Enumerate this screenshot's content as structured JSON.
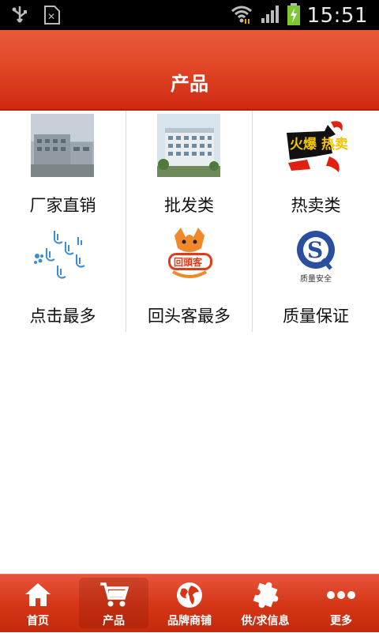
{
  "status": {
    "time": "15:51"
  },
  "header": {
    "title": "产品"
  },
  "grid": [
    {
      "label": "厂家直销",
      "icon": "factory-building-photo"
    },
    {
      "label": "批发类",
      "icon": "office-building-photo"
    },
    {
      "label": "热卖类",
      "icon": "hot-sale-badge",
      "badge_text": "火爆 热卖中"
    },
    {
      "label": "点击最多",
      "icon": "click-hands-icon"
    },
    {
      "label": "回头客最多",
      "icon": "fox-logo",
      "badge_text": "回頭客"
    },
    {
      "label": "质量保证",
      "icon": "quality-s-logo",
      "badge_text": "质量安全"
    }
  ],
  "tabs": [
    {
      "label": "首页",
      "icon": "home-icon"
    },
    {
      "label": "产品",
      "icon": "cart-icon",
      "active": true
    },
    {
      "label": "品牌商铺",
      "icon": "globe-icon"
    },
    {
      "label": "供/求信息",
      "icon": "puzzle-icon"
    },
    {
      "label": "更多",
      "icon": "more-dots-icon"
    }
  ],
  "colors": {
    "header": "#e24a2a",
    "tabbar": "#d53516"
  }
}
